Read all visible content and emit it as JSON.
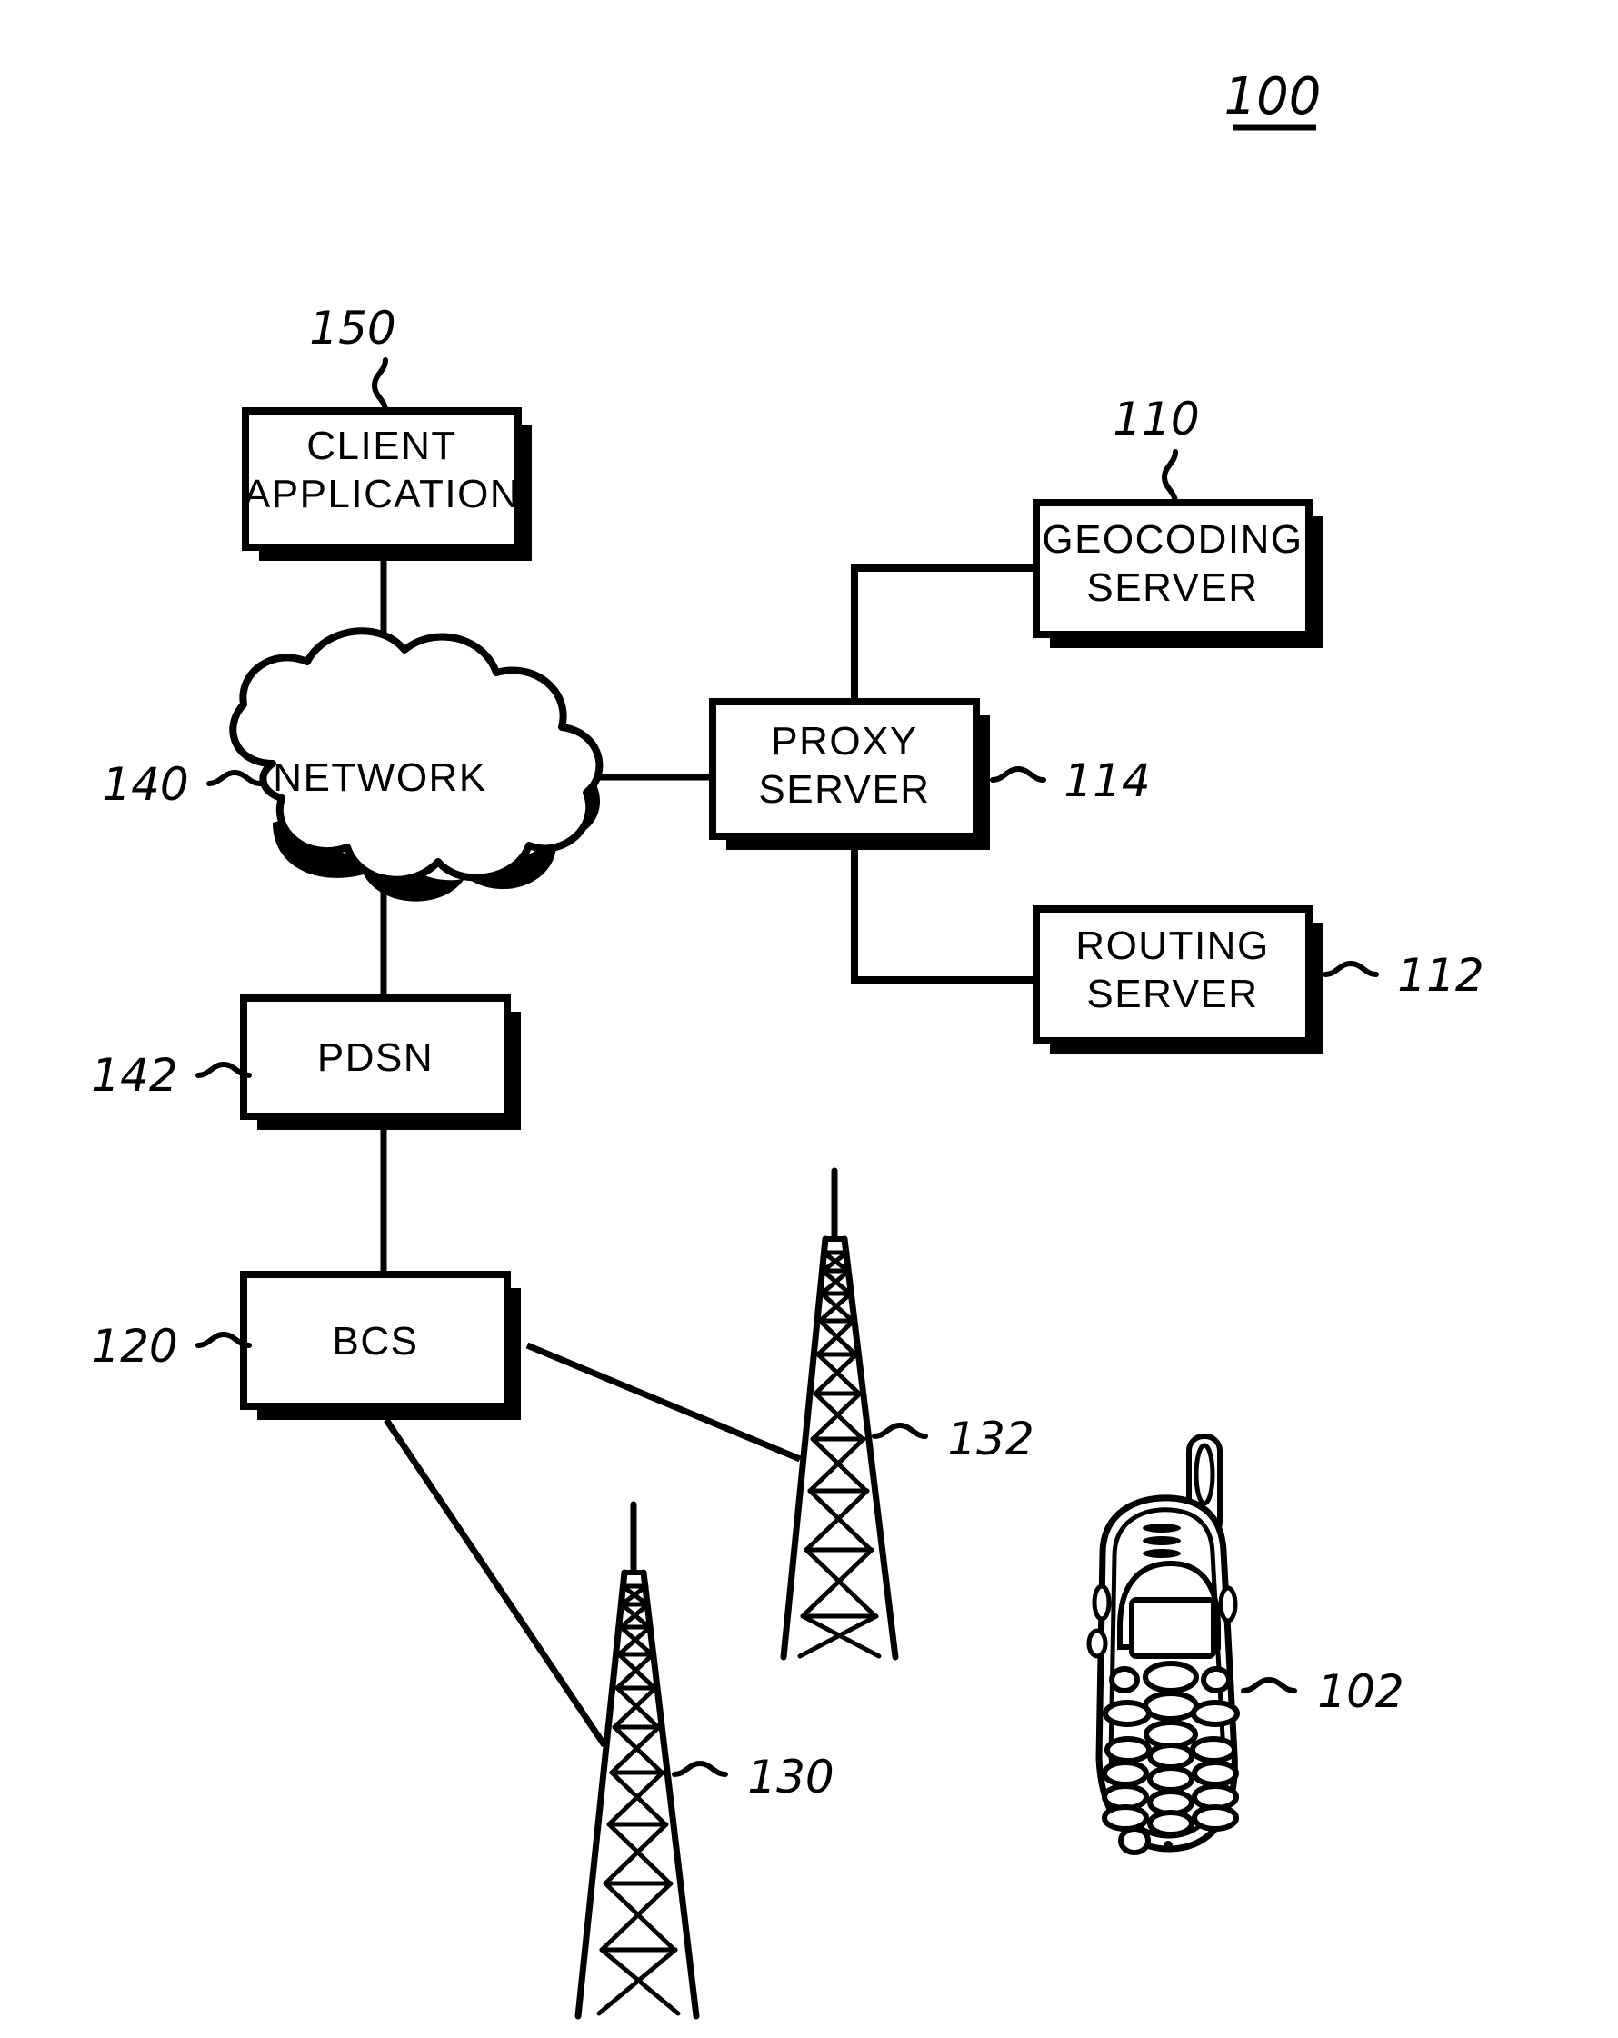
{
  "figure": {
    "number": "100",
    "type": "patent-network-diagram"
  },
  "nodes": {
    "client_application": {
      "ref": "150",
      "line1": "CLIENT",
      "line2": "APPLICATION"
    },
    "network": {
      "ref": "140",
      "label": "NETWORK"
    },
    "pdsn": {
      "ref": "142",
      "label": "PDSN"
    },
    "bcs": {
      "ref": "120",
      "label": "BCS"
    },
    "proxy_server": {
      "ref": "114",
      "line1": "PROXY",
      "line2": "SERVER"
    },
    "geocoding_server": {
      "ref": "110",
      "line1": "GEOCODING",
      "line2": "SERVER"
    },
    "routing_server": {
      "ref": "112",
      "line1": "ROUTING",
      "line2": "SERVER"
    },
    "tower_left": {
      "ref": "130",
      "name": "cell-tower"
    },
    "tower_right": {
      "ref": "132",
      "name": "cell-tower"
    },
    "mobile_phone": {
      "ref": "102",
      "name": "mobile-handset"
    }
  },
  "colors": {
    "stroke": "#000000",
    "fill": "#ffffff",
    "background": "#ffffff"
  }
}
